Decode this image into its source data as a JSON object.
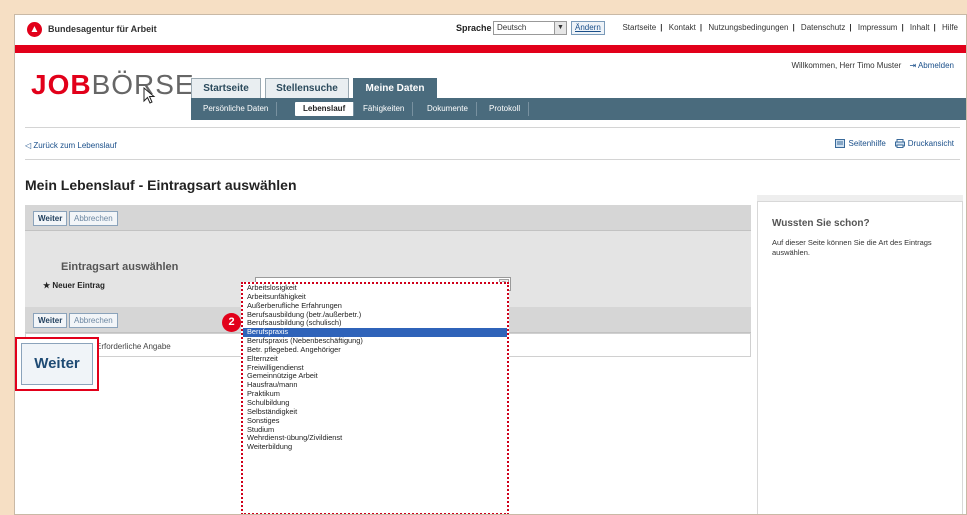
{
  "header": {
    "agency_name": "Bundesagentur für Arbeit",
    "language_label": "Sprache",
    "language_value": "Deutsch",
    "language_button": "Ändern",
    "links": [
      "Startseite",
      "Kontakt",
      "Nutzungsbedingungen",
      "Datenschutz",
      "Impressum",
      "Inhalt",
      "Hilfe"
    ],
    "welcome": "Willkommen, Herr Timo Muster",
    "logout": "Abmelden"
  },
  "logo": {
    "part1": "JOB",
    "part2": "BÖRSE"
  },
  "tabs": [
    "Startseite",
    "Stellensuche",
    "Meine Daten"
  ],
  "subnav": [
    "Persönliche Daten",
    "Lebenslauf",
    "Fähigkeiten",
    "Dokumente",
    "Protokoll"
  ],
  "toolbar": {
    "back": "Zurück zum Lebenslauf",
    "help": "Seitenhilfe",
    "print": "Druckansicht"
  },
  "page": {
    "title": "Mein Lebenslauf - Eintragsart auswählen",
    "section_title": "Eintragsart auswählen",
    "field_label": "Neuer Eintrag",
    "required_marker": "★",
    "next_label": "Weiter",
    "cancel_label": "Abbrechen",
    "required_note": "Erforderliche Angabe",
    "big_next_label": "Weiter"
  },
  "callout_number": "2",
  "dropdown_options": [
    "Arbeitslosigkeit",
    "Arbeitsunfähigkeit",
    "Außerberufliche Erfahrungen",
    "Berufsausbildung (betr./außerbetr.)",
    "Berufsausbildung (schulisch)",
    "Berufspraxis",
    "Berufspraxis (Nebenbeschäftigung)",
    "Betr. pflegebed. Angehöriger",
    "Elternzeit",
    "Freiwilligendienst",
    "Gemeinnützige Arbeit",
    "Hausfrau/mann",
    "Praktikum",
    "Schulbildung",
    "Selbständigkeit",
    "Sonstiges",
    "Studium",
    "Wehrdienst-übung/Zivildienst",
    "Weiterbildung"
  ],
  "selected_option": "Berufspraxis",
  "sidebar": {
    "title": "Wussten Sie schon?",
    "text": "Auf dieser Seite können Sie die Art des Eintrags auswählen."
  },
  "colors": {
    "brand_red": "#e2001a",
    "nav_dark": "#4a6b7d",
    "selection_blue": "#2f63b9"
  }
}
